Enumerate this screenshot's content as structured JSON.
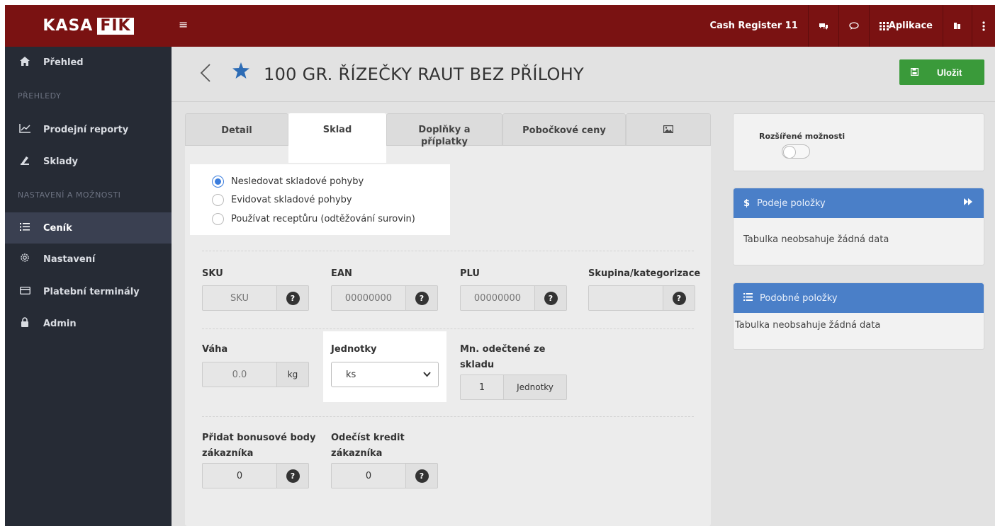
{
  "topbar": {
    "logo_left": "KASA",
    "logo_right": "FIK",
    "hamburger": "≡",
    "cash_register": "Cash Register 11",
    "apps_label": "Aplikace"
  },
  "sidebar": {
    "items": [
      {
        "label": "Přehled",
        "icon": "home-icon"
      },
      {
        "label": "Prodejní reporty",
        "icon": "chart-icon"
      },
      {
        "label": "Sklady",
        "icon": "warehouse-icon"
      },
      {
        "label": "Ceník",
        "icon": "list-icon"
      },
      {
        "label": "Nastavení",
        "icon": "gear-icon"
      },
      {
        "label": "Platební terminály",
        "icon": "card-icon"
      },
      {
        "label": "Admin",
        "icon": "lock-icon"
      }
    ],
    "sections": [
      "PŘEHLEDY",
      "NASTAVENÍ A MOŽNOSTI"
    ]
  },
  "header": {
    "title": "100 GR. ŘÍZEČKY RAUT BEZ PŘÍLOHY",
    "save_label": "Uložit"
  },
  "tabs": [
    {
      "label": "Detail"
    },
    {
      "label": "Sklad"
    },
    {
      "label_line1": "Doplňky a",
      "label_line2": "příplatky"
    },
    {
      "label": "Pobočkové ceny"
    }
  ],
  "stock": {
    "options": [
      "Nesledovat skladové pohyby",
      "Evidovat skladové pohyby",
      "Používat receptůru (odtěžování surovin)"
    ],
    "selected_index": 0
  },
  "fields": {
    "sku_label": "SKU",
    "sku_placeholder": "SKU",
    "ean_label": "EAN",
    "ean_placeholder": "00000000",
    "plu_label": "PLU",
    "plu_placeholder": "00000000",
    "group_label": "Skupina/kategorizace",
    "weight_label": "Váha",
    "weight_placeholder": "0.0",
    "weight_unit": "kg",
    "units_label": "Jednotky",
    "units_value": "ks",
    "deduct_label_line1": "Mn. odečtené ze",
    "deduct_label_line2": "skladu",
    "deduct_value": "1",
    "deduct_unit": "Jednotky",
    "bonus_label_line1": "Přidat bonusové body",
    "bonus_label_line2": "zákazníka",
    "bonus_value": "0",
    "credit_label_line1": "Odečíst kredit",
    "credit_label_line2": "zákazníka",
    "credit_value": "0",
    "help": "?"
  },
  "right": {
    "extended_options": "Rozšířené možnosti",
    "sales_title": "Podeje položky",
    "sales_empty": "Tabulka neobsahuje žádná data",
    "similar_title": "Podobné položky",
    "similar_empty": "Tabulka neobsahuje žádná data"
  },
  "colors": {
    "topbar": "#7a1212",
    "sidebar": "#262b35",
    "accent_blue": "#4a7fc8",
    "save_green": "#3a9a3a",
    "radio_blue": "#3b7ddd"
  }
}
